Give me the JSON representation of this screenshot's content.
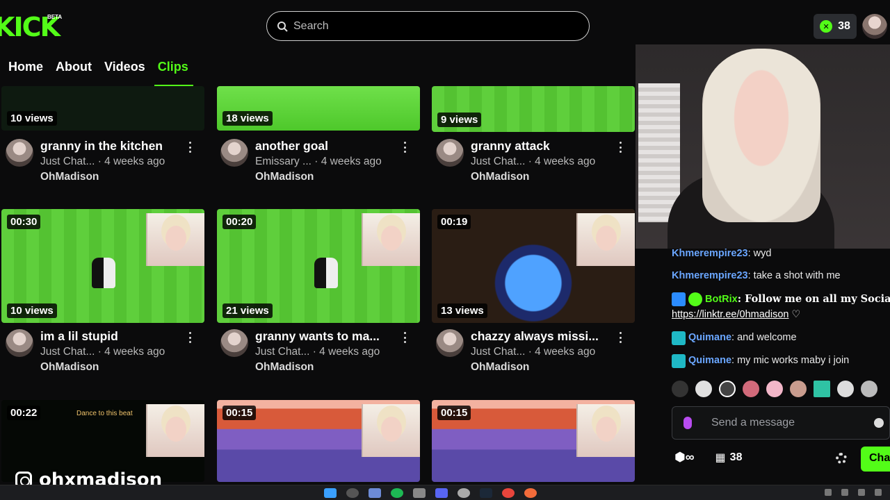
{
  "header": {
    "logo_text": "KICK",
    "beta_label": "BETA",
    "search_placeholder": "Search",
    "coins_count": "38"
  },
  "tabs": [
    {
      "label": "Home"
    },
    {
      "label": "About"
    },
    {
      "label": "Videos"
    },
    {
      "label": "Clips",
      "active": true
    }
  ],
  "clips": [
    {
      "duration": "",
      "views": "10 views",
      "title": "granny in the kitchen",
      "category": "Just Chat...",
      "age": "· 4 weeks ago",
      "owner": "OhMadison"
    },
    {
      "duration": "",
      "views": "18 views",
      "title": "another goal",
      "category": "Emissary ...",
      "age": "· 4 weeks ago",
      "owner": "OhMadison"
    },
    {
      "duration": "",
      "views": "9 views",
      "title": "granny attack",
      "category": "Just Chat...",
      "age": "· 4 weeks ago",
      "owner": "OhMadison"
    },
    {
      "duration": "00:30",
      "views": "10 views",
      "title": "im a lil stupid",
      "category": "Just Chat...",
      "age": "· 4 weeks ago",
      "owner": "OhMadison"
    },
    {
      "duration": "00:20",
      "views": "21 views",
      "title": "granny wants to ma...",
      "category": "Just Chat...",
      "age": "· 4 weeks ago",
      "owner": "OhMadison"
    },
    {
      "duration": "00:19",
      "views": "13 views",
      "title": "chazzy always missi...",
      "category": "Just Chat...",
      "age": "· 4 weeks ago",
      "owner": "OhMadison"
    },
    {
      "duration": "00:22",
      "views": "",
      "title": "",
      "category": "",
      "age": "",
      "owner": "",
      "overlay_text": "Dance to this beat"
    },
    {
      "duration": "00:15",
      "views": "",
      "title": "",
      "category": "",
      "age": "",
      "owner": ""
    },
    {
      "duration": "00:15",
      "views": "",
      "title": "",
      "category": "",
      "age": "",
      "owner": ""
    }
  ],
  "chat": {
    "messages": [
      {
        "user": "Khmerempire23",
        "text": ": wyd"
      },
      {
        "user": "Khmerempire23",
        "text": ": take a shot with me"
      },
      {
        "user": "BotRix",
        "text": ": Follow me on all my Socials →",
        "link": "https://linktr.ee/0hmadison",
        "suffix": " ♡"
      },
      {
        "user": "Quimane",
        "text": ": and welcome"
      },
      {
        "user": "Quimane",
        "text": ": my mic works maby i join"
      }
    ],
    "send_placeholder": "Send a message",
    "footer_count": "38",
    "chat_button": "Chat"
  },
  "watermark": "ohxmadison",
  "colors": {
    "accent": "#53fc18",
    "username": "#6aa6ff",
    "background": "#0b0b0c"
  }
}
